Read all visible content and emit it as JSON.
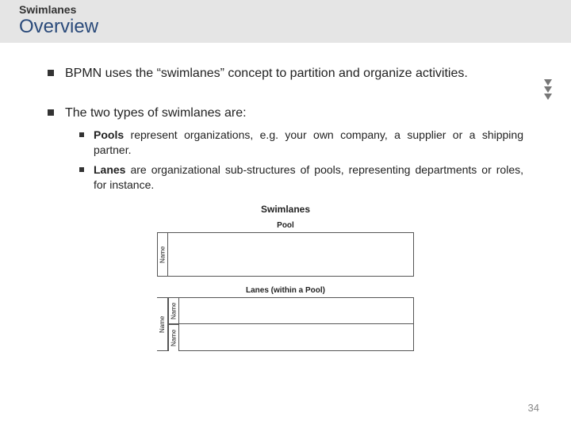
{
  "header": {
    "small": "Swimlanes",
    "large": "Overview"
  },
  "bullets": {
    "b1": "BPMN uses the “swimlanes” concept to partition and organize activities.",
    "b2": "The two types of swimlanes are:",
    "sub1_bold": "Pools",
    "sub1_rest": " represent organizations, e.g. your own company, a supplier or a shipping partner.",
    "sub2_bold": "Lanes",
    "sub2_rest": " are organizational sub-structures of pools, representing departments or roles, for instance."
  },
  "diagram": {
    "title": "Swimlanes",
    "pool_label": "Pool",
    "pool_vlabel": "Name",
    "lanes_label": "Lanes (within a Pool)",
    "lanes_vlabel_outer": "Name",
    "lanes_vlabel_inner": "Name"
  },
  "page_number": "34"
}
